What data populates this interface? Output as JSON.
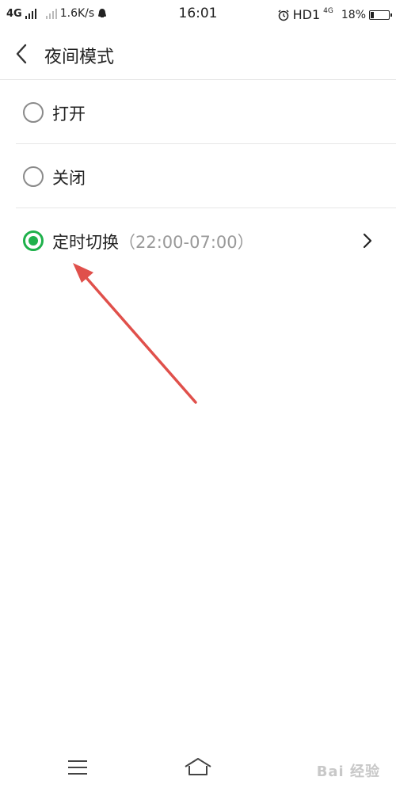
{
  "status_bar": {
    "left_network": "4G",
    "speed": "1.6K/s",
    "time": "16:01",
    "hd_label": "HD1",
    "right_network": "4G",
    "battery": "18%",
    "battery_level": 0.18
  },
  "header": {
    "title": "夜间模式",
    "back_icon": "chevron-left-icon"
  },
  "options": [
    {
      "label": "打开",
      "sub": "",
      "selected": false
    },
    {
      "label": "关闭",
      "sub": "",
      "selected": false
    },
    {
      "label": "定时切换",
      "sub": "（22:00-07:00）",
      "selected": true
    }
  ],
  "colors": {
    "accent": "#1fb14b",
    "annotation": "#e0504b"
  },
  "navbar": {
    "menu_icon": "menu-icon",
    "home_icon": "home-icon",
    "watermark": "Bai 经验"
  }
}
